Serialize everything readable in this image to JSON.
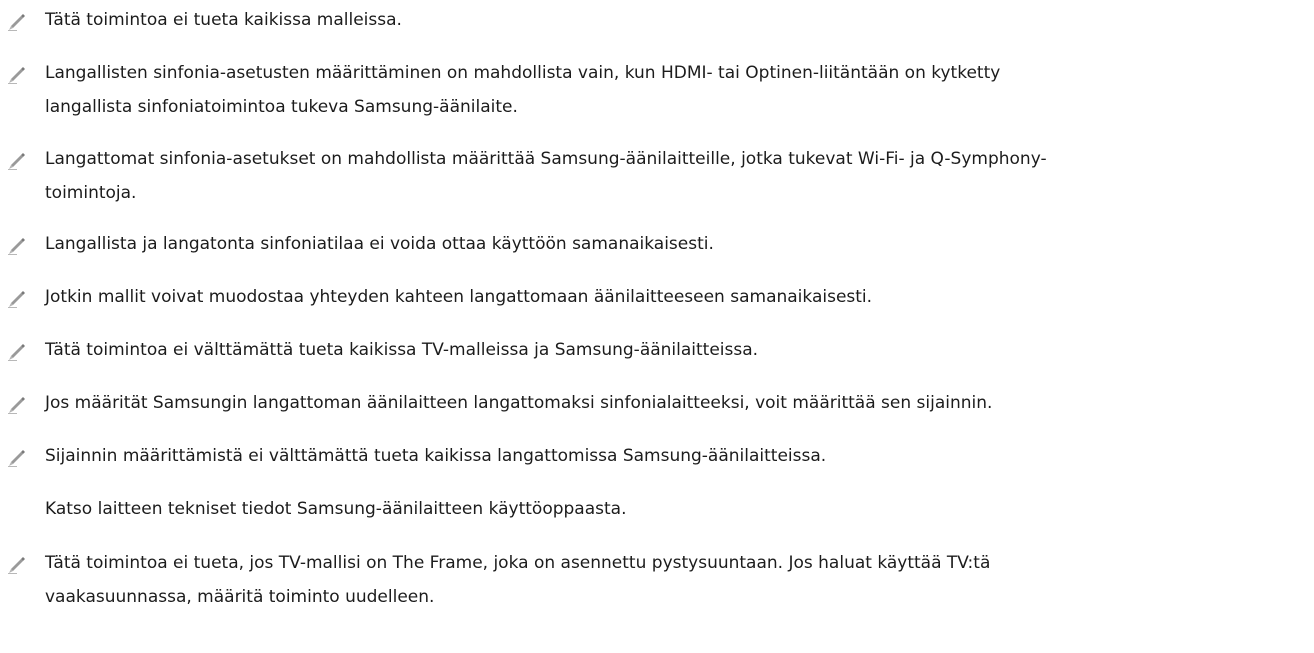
{
  "notes": [
    {
      "icon": "pencil-icon",
      "lines": [
        "Tätä toimintoa ei tueta kaikissa malleissa."
      ]
    },
    {
      "icon": "pencil-icon",
      "lines": [
        "Langallisten sinfonia-asetusten määrittäminen on mahdollista vain, kun HDMI- tai Optinen-liitäntään on kytketty",
        "langallista sinfoniatoimintoa tukeva Samsung-äänilaite."
      ]
    },
    {
      "icon": "pencil-icon",
      "lines": [
        "Langattomat sinfonia-asetukset on mahdollista määrittää Samsung-äänilaitteille, jotka tukevat Wi-Fi- ja Q-Symphony-",
        "toimintoja."
      ]
    },
    {
      "icon": "pencil-icon",
      "lines": [
        "Langallista ja langatonta sinfoniatilaa ei voida ottaa käyttöön samanaikaisesti."
      ]
    },
    {
      "icon": "pencil-icon",
      "lines": [
        "Jotkin mallit voivat muodostaa yhteyden kahteen langattomaan äänilaitteeseen samanaikaisesti."
      ]
    },
    {
      "icon": "pencil-icon",
      "lines": [
        "Tätä toimintoa ei välttämättä tueta kaikissa TV-malleissa ja Samsung-äänilaitteissa."
      ]
    },
    {
      "icon": "pencil-icon",
      "lines": [
        "Jos määrität Samsungin langattoman äänilaitteen langattomaksi sinfonialaitteeksi, voit määrittää sen sijainnin."
      ]
    },
    {
      "icon": "pencil-icon",
      "lines": [
        "Sijainnin määrittämistä ei välttämättä tueta kaikissa langattomissa Samsung-äänilaitteissa."
      ]
    },
    {
      "icon": "",
      "lines": [
        "Katso laitteen tekniset tiedot Samsung-äänilaitteen käyttöoppaasta."
      ]
    },
    {
      "icon": "pencil-icon",
      "lines": [
        "Tätä toimintoa ei tueta, jos TV-mallisi on The Frame, joka on asennettu pystysuuntaan. Jos haluat käyttää TV:tä",
        "vaakasuunnassa, määritä toiminto uudelleen."
      ]
    }
  ]
}
